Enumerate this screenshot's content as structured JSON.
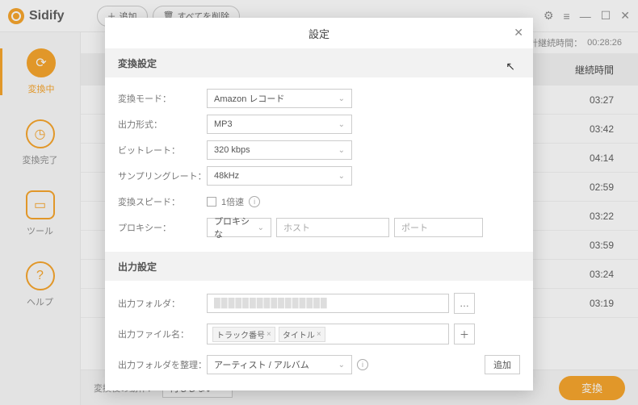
{
  "app": {
    "name": "Sidify"
  },
  "toolbar": {
    "add": "追加",
    "clear_all": "すべてを削除"
  },
  "sidebar": {
    "items": [
      {
        "label": "変換中"
      },
      {
        "label": "変換完了"
      },
      {
        "label": "ツール"
      },
      {
        "label": "ヘルプ"
      }
    ]
  },
  "info": {
    "total_duration_label": "合計継続時間：",
    "total_duration": "00:28:26"
  },
  "tracks": {
    "col_duration": "継続時間",
    "durations": [
      "03:27",
      "03:42",
      "04:14",
      "02:59",
      "03:22",
      "03:59",
      "03:24",
      "03:19"
    ]
  },
  "footer": {
    "after_label": "変換後の動作：",
    "after_value": "何もしない",
    "convert": "変換"
  },
  "modal": {
    "title": "設定",
    "sec_convert": "変換設定",
    "sec_output": "出力設定",
    "labels": {
      "mode": "変換モード：",
      "format": "出力形式：",
      "bitrate": "ビットレート：",
      "sample": "サンプリングレート：",
      "speed": "変換スピード：",
      "proxy": "プロキシー：",
      "out_folder": "出力フォルダ：",
      "out_filename": "出力ファイル名：",
      "organize": "出力フォルダを整理："
    },
    "values": {
      "mode": "Amazon レコード",
      "format": "MP3",
      "bitrate": "320 kbps",
      "sample": "48kHz",
      "speed": "1倍速",
      "proxy": "プロキシな",
      "host_ph": "ホスト",
      "port_ph": "ポート",
      "organize": "アーティスト / アルバム",
      "tag1": "トラック番号",
      "tag2": "タイトル",
      "add": "追加"
    }
  }
}
